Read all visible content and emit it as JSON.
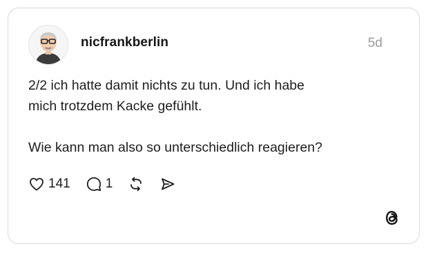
{
  "post": {
    "username": "nicfrankberlin",
    "time": "5d",
    "text_line1": "2/2 ich hatte damit nichts zu tun. Und ich habe",
    "text_line2": "mich trotzdem Kacke gefühlt.",
    "text_line3": "Wie kann man also so unterschiedlich reagieren?"
  },
  "actions": {
    "like": {
      "icon": "heart-icon",
      "count": "141"
    },
    "reply": {
      "icon": "comment-icon",
      "count": "1"
    },
    "repost": {
      "icon": "repost-icon"
    },
    "share": {
      "icon": "send-icon"
    }
  },
  "branding": {
    "icon": "threads-logo-icon"
  }
}
